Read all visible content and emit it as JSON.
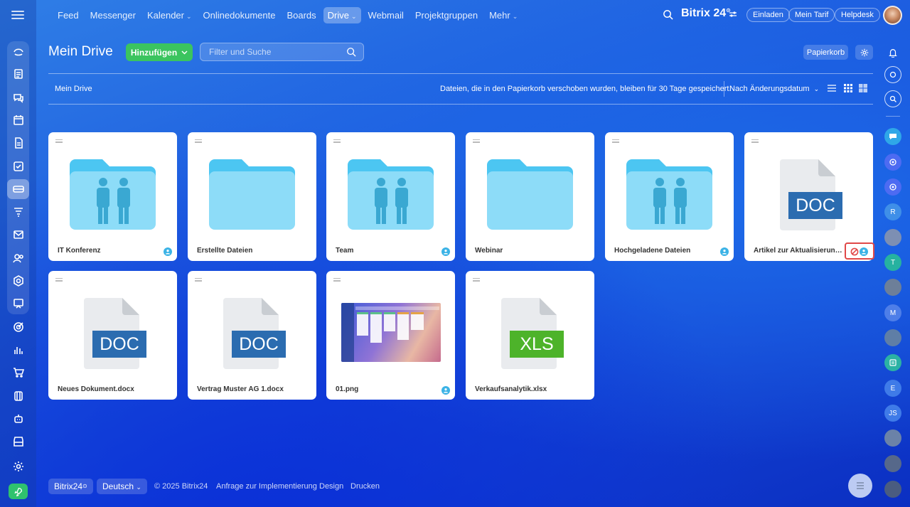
{
  "topnav": {
    "items": [
      {
        "label": "Feed"
      },
      {
        "label": "Messenger"
      },
      {
        "label": "Kalender",
        "caret": "⌄"
      },
      {
        "label": "Onlinedokumente"
      },
      {
        "label": "Boards"
      },
      {
        "label": "Drive",
        "caret": "⌄",
        "active": true
      },
      {
        "label": "Webmail"
      },
      {
        "label": "Projektgruppen"
      },
      {
        "label": "Mehr",
        "caret": "⌄"
      }
    ],
    "brand": "Bitrix 24",
    "invite": "Einladen",
    "plan": "Mein Tarif",
    "helpdesk": "Helpdesk"
  },
  "header": {
    "title": "Mein Drive",
    "add_label": "Hinzufügen",
    "filter_placeholder": "Filter und Suche",
    "trash_label": "Papierkorb"
  },
  "toolbar": {
    "breadcrumb": "Mein Drive",
    "info": "Dateien, die in den Papierkorb verschoben wurden, bleiben für 30 Tage gespeichert.",
    "sort_label": "Nach Änderungsdatum"
  },
  "files": [
    {
      "name": "IT Konferenz",
      "kind": "folder-shared",
      "shared": true
    },
    {
      "name": "Erstellte Dateien",
      "kind": "folder",
      "shared": false
    },
    {
      "name": "Team",
      "kind": "folder-shared",
      "shared": true
    },
    {
      "name": "Webinar",
      "kind": "folder",
      "shared": false
    },
    {
      "name": "Hochgeladene Dateien",
      "kind": "folder-shared",
      "shared": true
    },
    {
      "name": "Artikel zur Aktualisierung (...",
      "kind": "doc",
      "label": "DOC",
      "shared": true,
      "blocked": true
    },
    {
      "name": "Neues Dokument.docx",
      "kind": "doc",
      "label": "DOC",
      "shared": false
    },
    {
      "name": "Vertrag Muster AG 1.docx",
      "kind": "doc",
      "label": "DOC",
      "shared": false
    },
    {
      "name": "01.png",
      "kind": "image",
      "shared": true
    },
    {
      "name": "Verkaufsanalytik.xlsx",
      "kind": "xls",
      "label": "XLS",
      "shared": false
    }
  ],
  "right_bar": {
    "avatars": [
      "R",
      "T",
      "M",
      "E",
      "JS"
    ]
  },
  "footer": {
    "brand": "Bitrix24",
    "language": "Deutsch",
    "copyright": "© 2025 Bitrix24",
    "links": [
      "Anfrage zur Implementierung",
      "Design",
      "Drucken"
    ]
  },
  "colors": {
    "accent_green": "#3bc45f",
    "folder": "#8ddcf8",
    "folder_tab": "#4cc6f2",
    "doc_blue": "#2b6cb0",
    "xls_green": "#4db32a",
    "blocked_red": "#e04848"
  }
}
